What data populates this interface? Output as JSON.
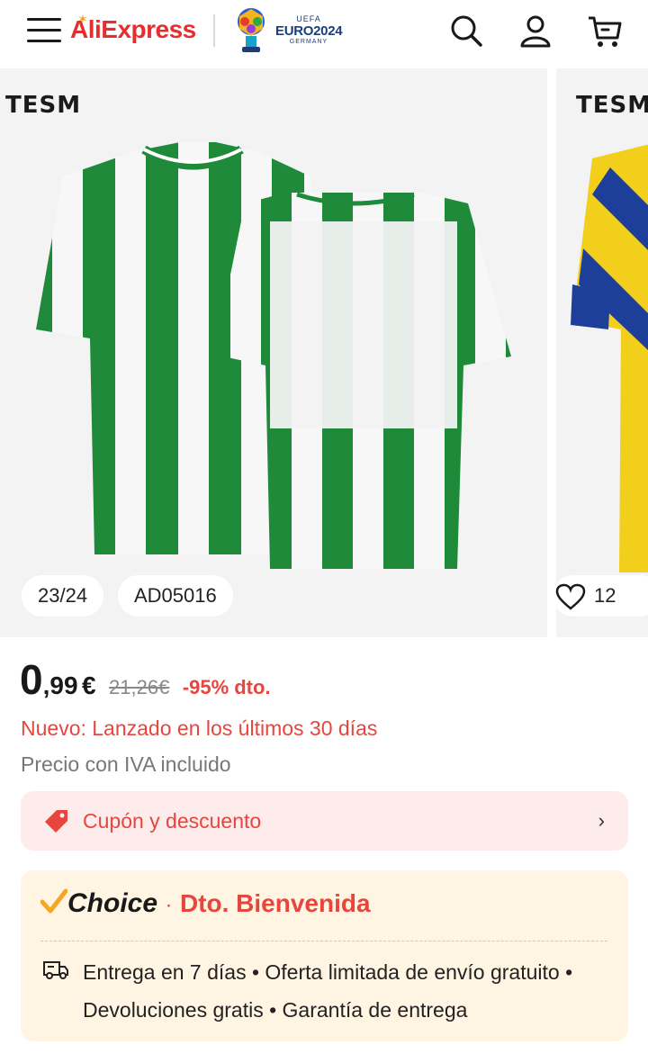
{
  "header": {
    "logo_text": "AliExpress",
    "euro_badge": {
      "uefa": "UEFA",
      "euro": "EURO2024",
      "country": "GERMANY"
    },
    "icons": [
      "menu-icon",
      "search-icon",
      "user-icon",
      "cart-icon"
    ]
  },
  "carousel": {
    "slides": [
      {
        "brand": "TESM",
        "colors": [
          "#1e8a3a",
          "#ffffff"
        ]
      },
      {
        "brand": "TESM",
        "colors": [
          "#f2cf1a",
          "#1d3f9a"
        ]
      }
    ],
    "chips": [
      "23/24",
      "AD05016"
    ],
    "wishlist_count": "12"
  },
  "price": {
    "integer": "0",
    "decimal": ",99",
    "currency": "€",
    "original": "21,26€",
    "discount": "-95% dto."
  },
  "badges": {
    "new": "Nuevo: Lanzado en los últimos 30 días",
    "vat": "Precio con IVA incluido"
  },
  "coupon": {
    "label": "Cupón y descuento",
    "arrow": "›"
  },
  "choice": {
    "title": "Choice",
    "separator": "·",
    "promo": "Dto. Bienvenida",
    "description": "Entrega en 7 días • Oferta limitada de envío gratuito • Devoluciones gratis • Garantía de entrega"
  },
  "colors": {
    "accent": "#e6463e",
    "choice_bg": "#fff5e2",
    "coupon_bg": "#fdeceb"
  }
}
